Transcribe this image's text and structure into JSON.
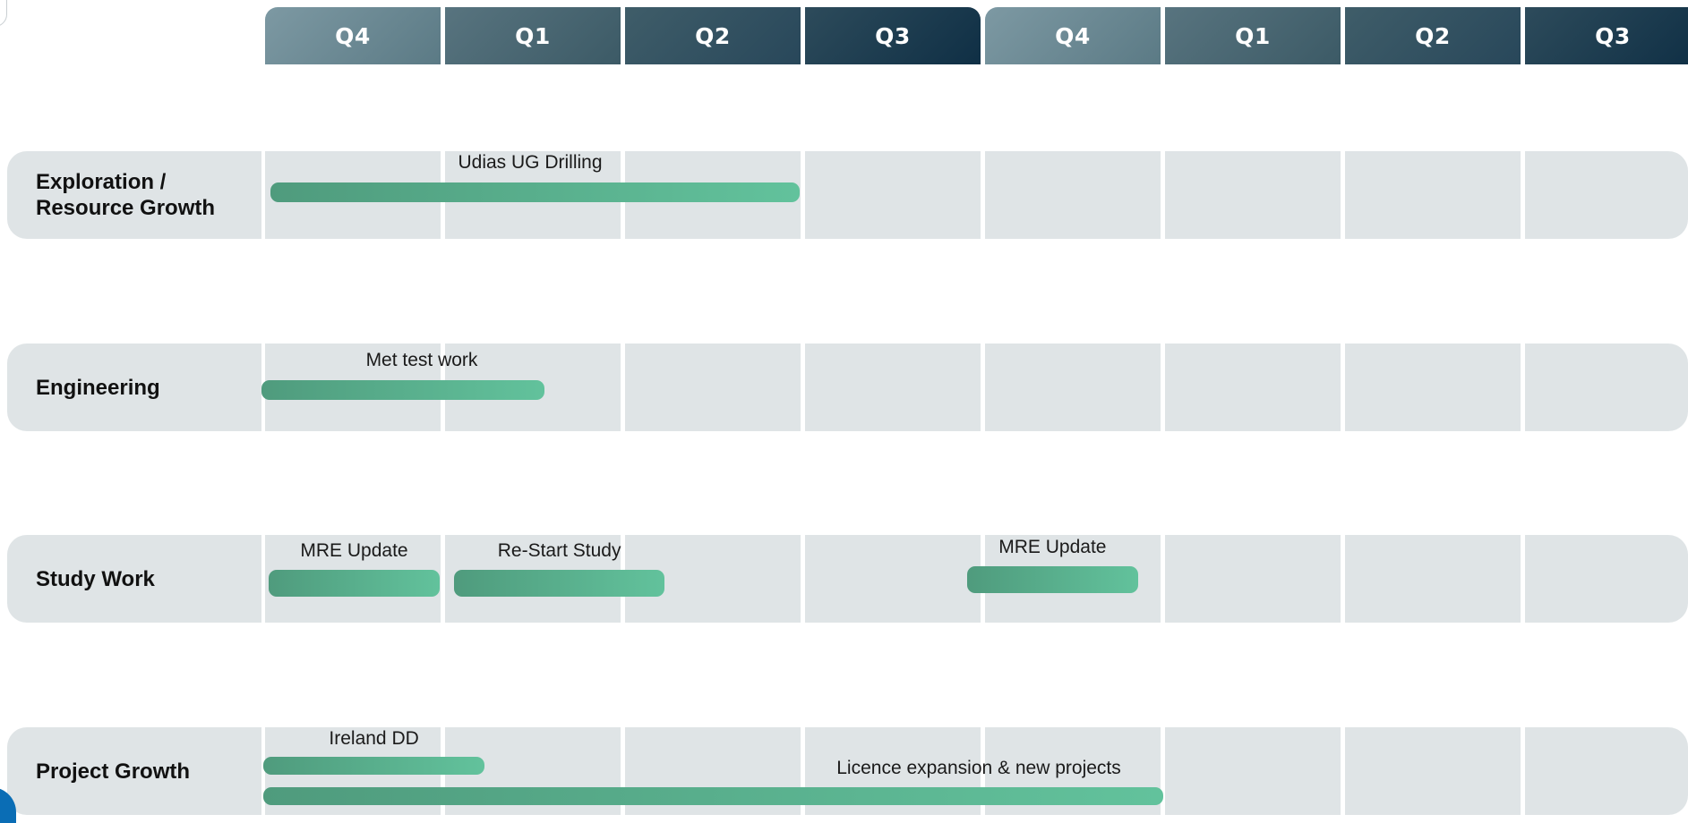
{
  "chart_data": {
    "type": "gantt",
    "quarters": [
      "Q4",
      "Q1",
      "Q2",
      "Q3",
      "Q4",
      "Q1",
      "Q2",
      "Q3"
    ],
    "rows": [
      {
        "label": "Exploration /\nResource Growth",
        "bars": [
          {
            "label": "Udias UG Drilling",
            "start": 0.03,
            "end": 2.97
          }
        ]
      },
      {
        "label": "Engineering",
        "bars": [
          {
            "label": "Met test work",
            "start": -0.02,
            "end": 1.55
          }
        ]
      },
      {
        "label": "Study Work",
        "bars": [
          {
            "label": "MRE Update",
            "start": 0.02,
            "end": 0.97
          },
          {
            "label": "Re-Start Study",
            "start": 1.05,
            "end": 2.22
          },
          {
            "label": "MRE Update",
            "start": 3.9,
            "end": 4.85
          }
        ]
      },
      {
        "label": "Project Growth",
        "bars": [
          {
            "label": "Ireland DD",
            "start": -0.01,
            "end": 1.22
          },
          {
            "label": "Licence expansion & new projects",
            "start": -0.01,
            "end": 4.99
          }
        ]
      }
    ],
    "colors": {
      "bar_start": "#4f9b7d",
      "bar_end": "#62c29c",
      "row_background": "#dfe4e6",
      "header_light": "#7d99a3",
      "header_dark": "#0f2f45"
    }
  }
}
